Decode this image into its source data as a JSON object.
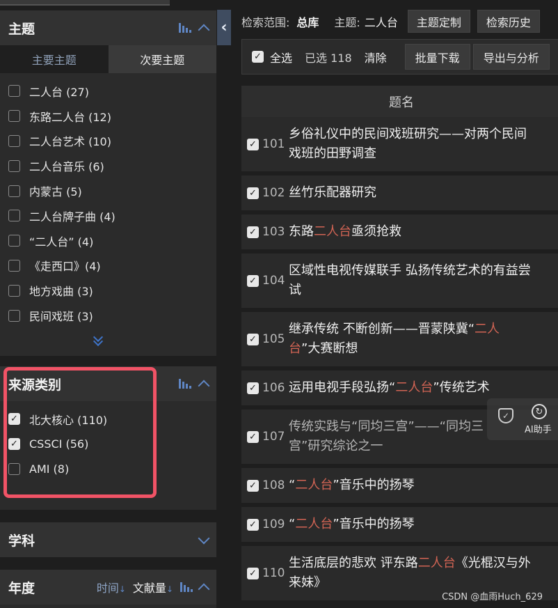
{
  "sidebar": {
    "topic_panel": {
      "title": "主题",
      "tabs": [
        {
          "label": "主要主题",
          "active": true
        },
        {
          "label": "次要主题",
          "active": false
        }
      ],
      "items": [
        {
          "label": "二人台 (27)",
          "checked": false
        },
        {
          "label": "东路二人台 (12)",
          "checked": false
        },
        {
          "label": "二人台艺术 (10)",
          "checked": false
        },
        {
          "label": "二人台音乐 (6)",
          "checked": false
        },
        {
          "label": "内蒙古 (5)",
          "checked": false
        },
        {
          "label": "二人台牌子曲 (4)",
          "checked": false
        },
        {
          "label": "“二人台” (4)",
          "checked": false
        },
        {
          "label": "《走西口》(4)",
          "checked": false
        },
        {
          "label": "地方戏曲 (3)",
          "checked": false
        },
        {
          "label": "民间戏班 (3)",
          "checked": false
        }
      ]
    },
    "source_panel": {
      "title": "来源类别",
      "items": [
        {
          "label": "北大核心 (110)",
          "checked": true
        },
        {
          "label": "CSSCI (56)",
          "checked": true
        },
        {
          "label": "AMI (8)",
          "checked": false
        }
      ]
    },
    "subject_panel": {
      "title": "学科"
    },
    "year_panel": {
      "title": "年度",
      "sort_time": "时间",
      "sort_count": "文献量"
    }
  },
  "header": {
    "scope_label": "检索范围:",
    "scope_value": "总库",
    "topic_label": "主题:",
    "topic_value": "二人台",
    "btn_custom": "主题定制",
    "btn_history": "检索历史"
  },
  "toolbar": {
    "select_all": "全选",
    "selected_count": "已选 118",
    "clear": "清除",
    "btn_download": "批量下载",
    "btn_export": "导出与分析"
  },
  "results": {
    "column_title": "题名",
    "rows": [
      {
        "num": "101",
        "parts": [
          "乡俗礼仪中的民间戏班研究——对两个民间"
        ],
        "line2": [
          "戏班的田野调查"
        ],
        "hl": []
      },
      {
        "num": "102",
        "parts": [
          "丝竹乐配器研究"
        ],
        "hl": []
      },
      {
        "num": "103",
        "parts": [
          "东路",
          "二人台",
          "亟须抢救"
        ],
        "hl": [
          1
        ]
      },
      {
        "num": "104",
        "parts": [
          "区域性电视传媒联手 弘扬传统艺术的有益尝"
        ],
        "line2": [
          "试"
        ],
        "hl": []
      },
      {
        "num": "105",
        "parts": [
          "继承传统 不断创新——晋蒙陕冀“",
          "二人"
        ],
        "line2": [
          "台",
          "”大赛断想"
        ],
        "hl": [
          1
        ],
        "hl2": [
          0
        ]
      },
      {
        "num": "106",
        "parts": [
          "运用电视手段弘扬“",
          "二人台",
          "”传统艺术"
        ],
        "hl": [
          1
        ]
      },
      {
        "num": "107",
        "parts": [
          "传统实践与“同均三宫”——“同均三"
        ],
        "line2": [
          "宫”研究综论之一"
        ],
        "hl": [],
        "dim": true
      },
      {
        "num": "108",
        "parts": [
          "“",
          "二人台",
          "”音乐中的扬琴"
        ],
        "hl": [
          1
        ]
      },
      {
        "num": "109",
        "parts": [
          "“",
          "二人台",
          "”音乐中的扬琴"
        ],
        "hl": [
          1
        ]
      },
      {
        "num": "110",
        "parts": [
          "生活底层的悲欢 评东路",
          "二人台",
          "《光棍汉与外"
        ],
        "line2": [
          "来妹》"
        ],
        "hl": [
          1
        ]
      }
    ]
  },
  "ai_widget": {
    "label": "AI助手"
  },
  "watermark": "CSDN @血雨Huch_629",
  "colors": {
    "highlight_box": "#f15366",
    "keyword": "#d26454",
    "accent": "#5f86c4"
  }
}
